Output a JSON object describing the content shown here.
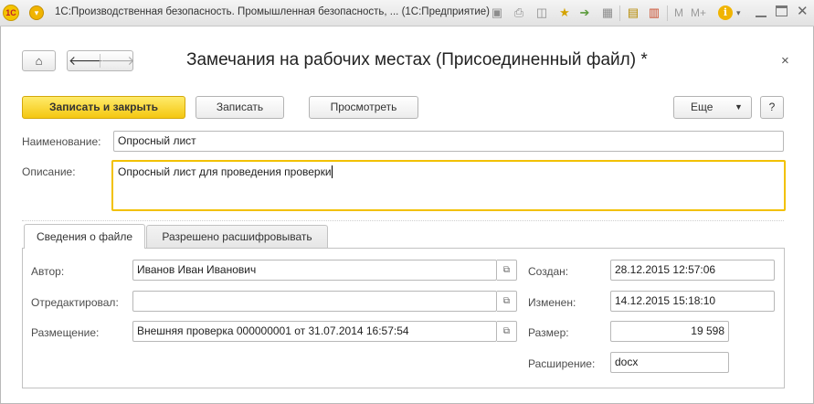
{
  "window": {
    "title": "1С:Производственная безопасность. Промышленная безопасность, ...  (1С:Предприятие)",
    "logo": "1С",
    "toolbar_icons": [
      "save-icon",
      "print-icon",
      "preview-icon",
      "favorite-icon",
      "history-icon",
      "spreadsheet-icon",
      "calendar-icon"
    ],
    "memory_buttons": [
      "M",
      "M+",
      "M-"
    ],
    "info_glyph": "i"
  },
  "nav": {
    "home_icon": "home-icon",
    "back_icon": "arrow-left-icon",
    "forward_icon": "arrow-right-icon"
  },
  "form": {
    "title": "Замечания на рабочих местах (Присоединенный файл) *",
    "close_glyph": "×"
  },
  "toolbar": {
    "save_close_label": "Записать и закрыть",
    "save_label": "Записать",
    "view_label": "Просмотреть",
    "more_label": "Еще",
    "help_label": "?"
  },
  "fields": {
    "name_label": "Наименование:",
    "name_value": "Опросный лист",
    "description_label": "Описание:",
    "description_value": "Опросный лист для проведения проверки"
  },
  "tabs": [
    {
      "label": "Сведения о файле",
      "active": true
    },
    {
      "label": "Разрешено расшифровывать",
      "active": false
    }
  ],
  "file_info": {
    "author_label": "Автор:",
    "author_value": "Иванов Иван Иванович",
    "edited_label": "Отредактировал:",
    "edited_value": "",
    "location_label": "Размещение:",
    "location_value": "Внешняя проверка 000000001 от 31.07.2014 16:57:54",
    "created_label": "Создан:",
    "created_value": "28.12.2015 12:57:06",
    "modified_label": "Изменен:",
    "modified_value": "14.12.2015 15:18:10",
    "size_label": "Размер:",
    "size_value": "19 598",
    "extension_label": "Расширение:",
    "extension_value": "docx"
  },
  "colors": {
    "primary_button": "#f4c711",
    "active_field_border": "#f2c100"
  }
}
